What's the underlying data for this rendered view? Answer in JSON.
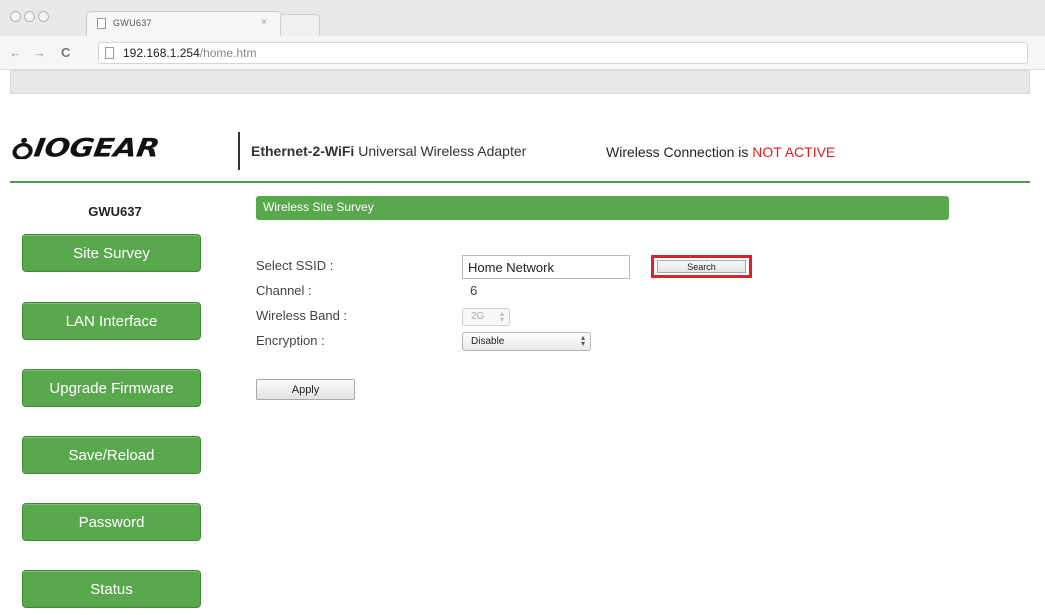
{
  "browser": {
    "tab_title": "GWU637",
    "tab_close": "×",
    "url_host": "192.168.1.254",
    "url_path": "/home.htm",
    "back_glyph": "←",
    "forward_glyph": "→",
    "reload_glyph": "C"
  },
  "header": {
    "logo": "IOGEAR",
    "product_bold": "Ethernet-2-WiFi",
    "product_rest": " Universal Wireless Adapter",
    "connection_prefix": "Wireless Connection is ",
    "connection_status": "NOT ACTIVE",
    "status_color": "#e02020",
    "accent_color": "#5aa84e"
  },
  "sidebar": {
    "model": "GWU637",
    "items": [
      {
        "label": "Site Survey"
      },
      {
        "label": "LAN Interface"
      },
      {
        "label": "Upgrade Firmware"
      },
      {
        "label": "Save/Reload"
      },
      {
        "label": "Password"
      },
      {
        "label": "Status"
      }
    ]
  },
  "main": {
    "panel_title": "Wireless Site Survey",
    "labels": {
      "ssid": "Select SSID :",
      "channel": "Channel :",
      "band": "Wireless Band :",
      "encryption": "Encryption :"
    },
    "ssid_value": "Home Network",
    "search_label": "Search",
    "channel_value": "6",
    "band_value": "2G",
    "encryption_value": "Disable",
    "apply_label": "Apply"
  }
}
